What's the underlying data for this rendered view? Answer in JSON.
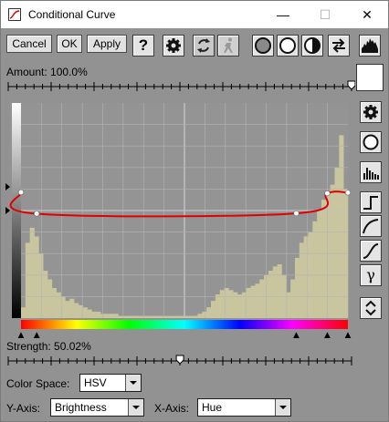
{
  "window": {
    "title": "Conditional Curve",
    "minimize_glyph": "—",
    "maximize_glyph": "☐",
    "close_glyph": "✕"
  },
  "toolbar": {
    "cancel_label": "Cancel",
    "ok_label": "OK",
    "apply_label": "Apply",
    "help_label": "?",
    "icons": [
      "gear-icon",
      "refresh-icon",
      "walker-icon",
      "circle-dark-icon",
      "circle-white-icon",
      "half-circle-icon",
      "swap-icon",
      "histogram-icon"
    ]
  },
  "amount": {
    "label": "Amount:",
    "value": "100.0%",
    "fraction": 1.0
  },
  "strength": {
    "label": "Strength:",
    "value": "50.02%",
    "fraction": 0.5002
  },
  "color_space": {
    "label": "Color Space:",
    "value": "HSV"
  },
  "y_axis": {
    "label": "Y-Axis:",
    "value": "Brightness"
  },
  "x_axis": {
    "label": "X-Axis:",
    "value": "Hue"
  },
  "side_buttons": [
    "gear-icon",
    "circle-icon",
    "histogram-icon",
    "curve-step-icon",
    "curve-log-icon",
    "curve-s-icon",
    "gamma-icon",
    "up-down-icon"
  ],
  "gamma_label": "γ",
  "curve": {
    "x_axis_range": [
      0,
      1
    ],
    "y_axis_range": [
      0,
      1
    ],
    "points": [
      [
        0.0,
        0.585
      ],
      [
        0.048,
        0.485
      ],
      [
        0.842,
        0.487
      ],
      [
        0.937,
        0.58
      ],
      [
        1.0,
        0.583
      ]
    ],
    "line_color": "#e00000",
    "histogram_color": "#c9c59e",
    "background_color": "#949494",
    "histogram_levels": [
      0.05,
      0.35,
      0.42,
      0.38,
      0.3,
      0.22,
      0.18,
      0.14,
      0.12,
      0.1,
      0.08,
      0.09,
      0.07,
      0.06,
      0.05,
      0.04,
      0.03,
      0.03,
      0.02,
      0.02,
      0.02,
      0.02,
      0.01,
      0.01,
      0.01,
      0.01,
      0.01,
      0.01,
      0.01,
      0.01,
      0.01,
      0.01,
      0.01,
      0.01,
      0.01,
      0.01,
      0.01,
      0.01,
      0.01,
      0.01,
      0.02,
      0.03,
      0.05,
      0.08,
      0.11,
      0.13,
      0.14,
      0.13,
      0.12,
      0.11,
      0.12,
      0.14,
      0.15,
      0.16,
      0.18,
      0.2,
      0.22,
      0.24,
      0.25,
      0.2,
      0.12,
      0.18,
      0.28,
      0.35,
      0.38,
      0.4,
      0.45,
      0.5,
      0.55,
      0.58,
      0.62,
      0.7,
      0.85,
      0.6
    ]
  },
  "channel_markers": [
    "▲",
    "▲",
    "▲",
    "▲",
    "▲"
  ]
}
